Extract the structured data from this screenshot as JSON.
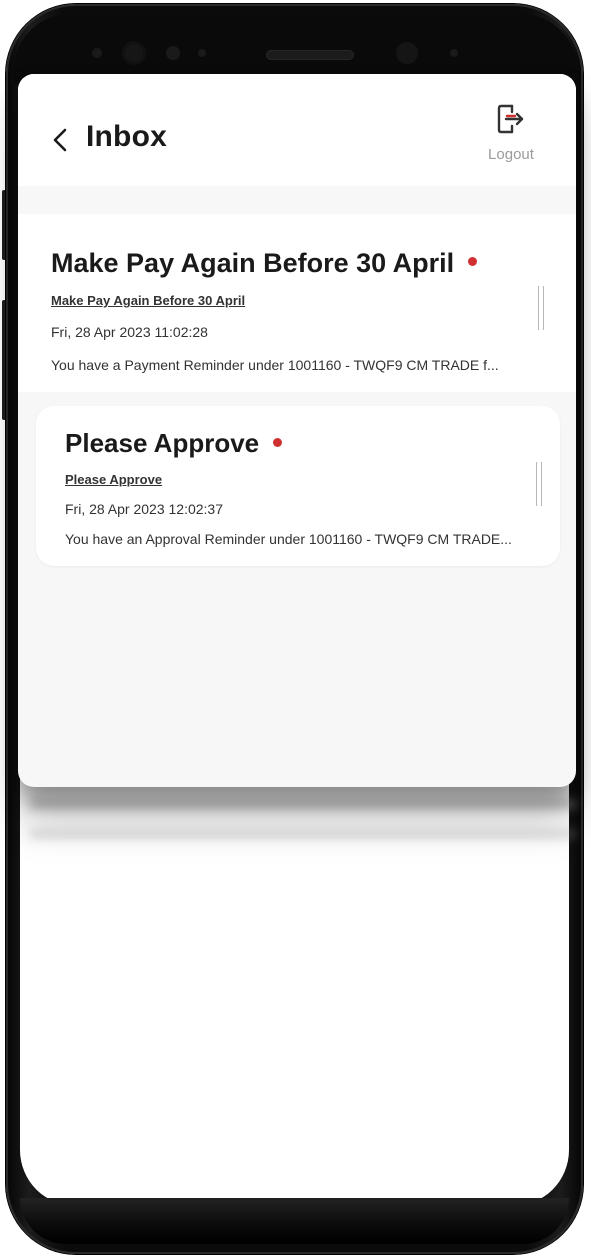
{
  "header": {
    "title": "Inbox",
    "logout_label": "Logout",
    "back_icon": "chevron-left-icon",
    "logout_icon": "logout-icon"
  },
  "colors": {
    "unread_dot": "#d0302f",
    "logout_arrow": "#d0302f",
    "title_text": "#1a1a1a"
  },
  "messages": [
    {
      "title": "Make Pay Again Before 30 April",
      "subject": "Make Pay Again Before 30 April",
      "date": "Fri, 28 Apr 2023 11:02:28",
      "preview": "You have a Payment Reminder under 1001160 - TWQF9 CM TRADE f...",
      "unread": true
    },
    {
      "title": "Please Approve",
      "subject": "Please Approve",
      "date": "Fri, 28 Apr 2023 12:02:37",
      "preview": "You have an Approval Reminder under 1001160 - TWQF9 CM TRADE...",
      "unread": true
    }
  ]
}
